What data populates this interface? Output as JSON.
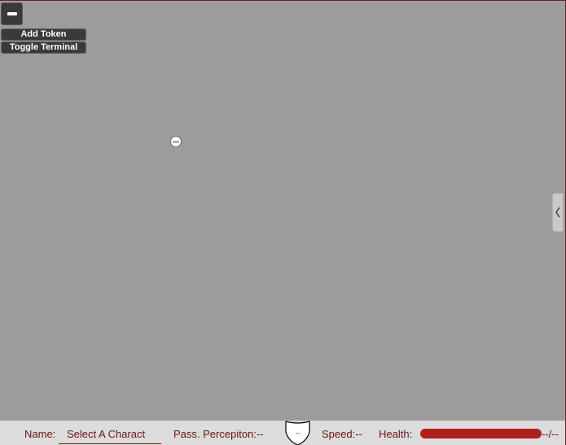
{
  "toolbar": {
    "collapse_icon": "minus-icon",
    "add_token_label": "Add Token",
    "toggle_terminal_label": "Toggle Terminal"
  },
  "map": {
    "background_color": "#9c9c9c",
    "token_icon": "token-circle-icon"
  },
  "side_panel": {
    "toggle_icon": "chevron-left-icon"
  },
  "status_bar": {
    "name_label": "Name:",
    "name_value": "Select A Charact",
    "perception_label": "Pass. Percepiton:--",
    "armor_icon": "shield-icon",
    "armor_value": "--",
    "speed_label": "Speed:--",
    "health_label": "Health:",
    "health_text": "--/--",
    "health_fill": 1.0,
    "text_color": "#6b1414",
    "health_color": "#b01e1e"
  }
}
